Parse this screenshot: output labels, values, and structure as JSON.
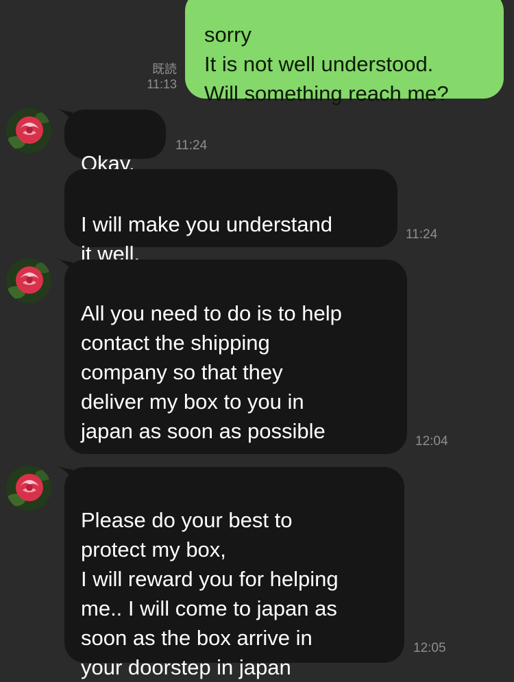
{
  "messages": {
    "sent_1": {
      "text": "sorry\nIt is not well understood.\nWill something reach me?",
      "read_label": "既読",
      "time": "11:13"
    },
    "recv_1": {
      "text": "Okay.",
      "time": "11:24"
    },
    "recv_2": {
      "text": "I will make you understand\nit well.",
      "time": "11:24"
    },
    "recv_3": {
      "text": "All you need to do is to help\ncontact the shipping\ncompany so that they\ndeliver my box to you in\njapan as soon as possible",
      "time": "12:04"
    },
    "recv_4": {
      "text": "Please do your best to\nprotect my box,\nI will reward you for helping\nme.. I will come to japan as\nsoon as the box arrive in\nyour doorstep in japan",
      "time": "12:05"
    }
  },
  "contact": {
    "avatar_icon": "rose-avatar-icon"
  },
  "colors": {
    "background": "#2b2b2b",
    "incoming_bubble": "#161616",
    "outgoing_bubble": "#85d86a",
    "timestamp": "#8f8f8f"
  }
}
